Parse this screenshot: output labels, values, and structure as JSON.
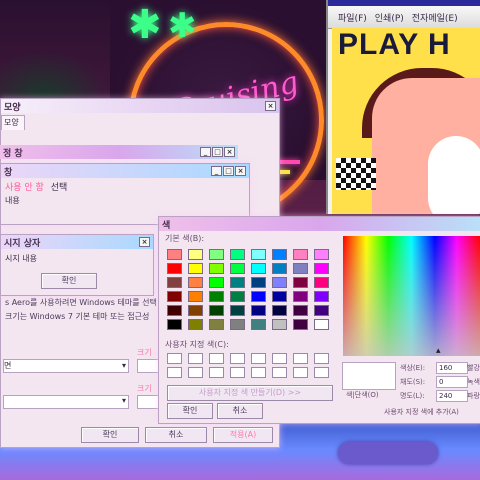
{
  "poster": {
    "menu": [
      "파일(F)",
      "인쇄(P)",
      "전자메일(E)"
    ],
    "headline": "PLAY H"
  },
  "dlg_theme": {
    "title": "모양",
    "tab": "모양",
    "ok_label": "확인",
    "cancel_label": "취소",
    "apply_label": "적용(A)",
    "aero_text1": "s Aero를 사용하려면 Windows 테마를 선택",
    "aero_text2": "크기는 Windows 7 기본 테마 또는 접근성",
    "size_label1": "크기",
    "size_label2": "크기",
    "item_value": "면"
  },
  "dlg_active": {
    "title": "정 창"
  },
  "dlg_disabled": {
    "title": "창",
    "menu_disabled": "사용 안 함",
    "menu_select": "선택",
    "body": "내용"
  },
  "dlg_msgbox": {
    "title": "시지 상자",
    "body": "시지 내용",
    "ok_label": "확인"
  },
  "dlg_color": {
    "title": "색",
    "basic_label": "기본 색(B):",
    "custom_label": "사용자 지정 색(C):",
    "define_button": "사용자 지정 색 만들기(D) >>",
    "ok_label": "확인",
    "cancel_label": "취소",
    "solid_label": "색|단색(O)",
    "hue_label": "색상(E):",
    "hue_value": "160",
    "sat_label": "채도(S):",
    "sat_value": "0",
    "lum_label": "명도(L):",
    "lum_value": "240",
    "red_label": "빨강",
    "green_label": "녹색",
    "blue_label": "파랑",
    "add_custom": "사용자 지정 색에 추가(A)",
    "basic_colors": [
      "#ff8080",
      "#ffff80",
      "#80ff80",
      "#00ff80",
      "#80ffff",
      "#0080ff",
      "#ff80c0",
      "#ff80ff",
      "#ff0000",
      "#ffff00",
      "#80ff00",
      "#00ff40",
      "#00ffff",
      "#0080c0",
      "#8080c0",
      "#ff00ff",
      "#804040",
      "#ff8040",
      "#00ff00",
      "#008080",
      "#004080",
      "#8080ff",
      "#800040",
      "#ff0080",
      "#800000",
      "#ff8000",
      "#008000",
      "#008040",
      "#0000ff",
      "#0000a0",
      "#800080",
      "#8000ff",
      "#400000",
      "#804000",
      "#004000",
      "#004040",
      "#000080",
      "#000040",
      "#400040",
      "#400080",
      "#000000",
      "#808000",
      "#808040",
      "#808080",
      "#408080",
      "#c0c0c0",
      "#400040",
      "#ffffff"
    ]
  }
}
